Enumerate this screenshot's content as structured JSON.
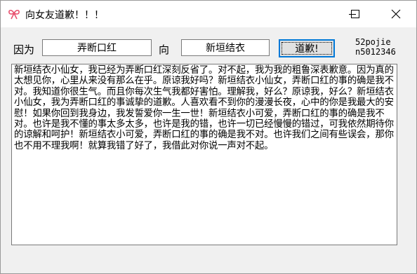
{
  "window": {
    "title": "向女友道歉！！！",
    "icon": "pink-ribbon-icon",
    "controls": [
      "minimize-icon",
      "maximize-icon",
      "close-icon"
    ]
  },
  "form": {
    "reason_label": "因为",
    "reason_value": "弄断口红",
    "to_label": "向",
    "recipient_value": "新垣结衣",
    "apologize_button": "道歉!"
  },
  "credit": {
    "line1": "52pojie",
    "line2": "n5012346"
  },
  "message": {
    "text": "新垣结衣小仙女，我已经为弄断口红深刻反省了。对不起，我为我的粗鲁深表歉意。因为真的太想见你，心里从来没有那么在乎。原谅我好吗？新垣结衣小仙女，弄断口红的事的确是我不对。我知道你很生气。而且你每次生气我都好害怕。理解我，好么？原谅我，好么？新垣结衣小仙女，我为弄断口红的事诚挚的道歉。人喜欢看不到你的漫漫长夜，心中的你是我最大的安慰！如果你回到我身边，我发誓爱你一生一世！新垣结衣小可爱，弄断口红的事的确是我不对。也许是我不懂的事太多太多，也许是我的错，也许一切已经慢慢的错过，可我依然期待你的谅解和呵护！新垣结衣小可爱，弄断口红的事的确是我不对。也许我们之间有些误会，那你也不用不理我啊！就算我错了好了，我借此对你说一声对不起。"
  },
  "colors": {
    "titlebar": "#ffffff",
    "window_bg": "#f0f0f0",
    "button_focus": "#0078d7",
    "button_face": "#e1e1e1",
    "icon_pink": "#e8506e"
  }
}
